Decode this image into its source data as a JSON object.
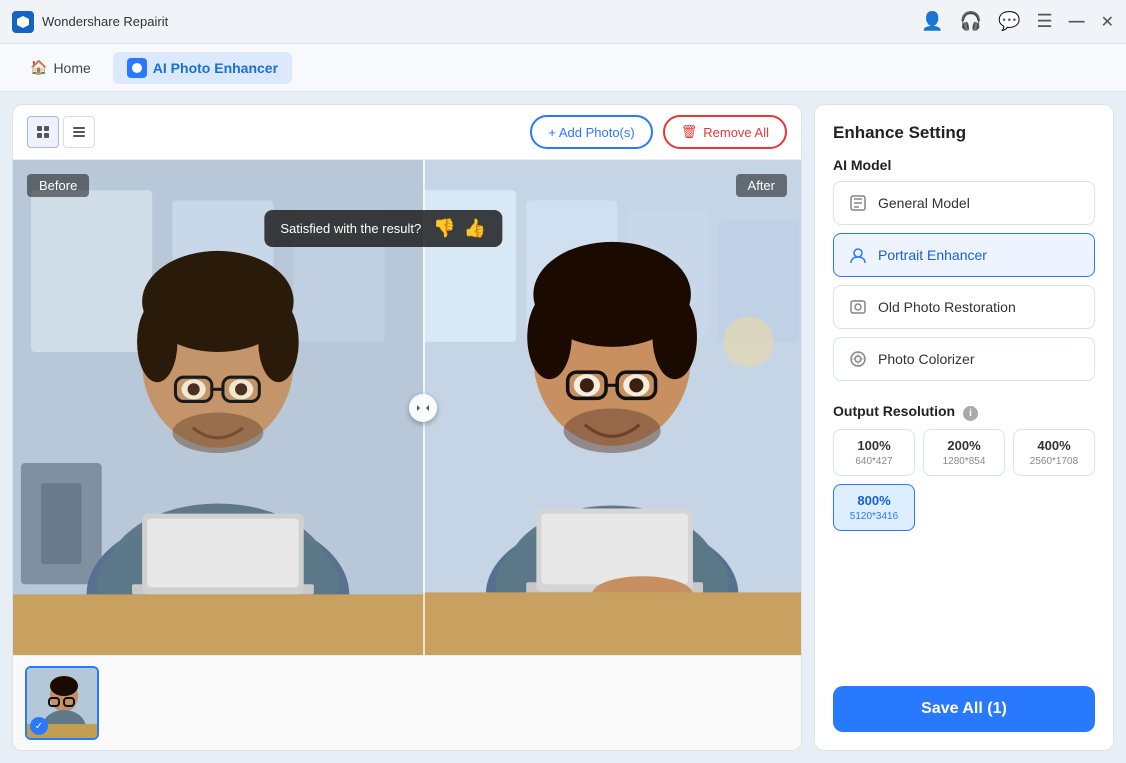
{
  "titleBar": {
    "appName": "Wondershare Repairit",
    "controls": {
      "minimize": "—",
      "close": "✕"
    }
  },
  "navBar": {
    "homeLabel": "Home",
    "activeTab": "AI Photo Enhancer"
  },
  "toolbar": {
    "addPhotosLabel": "+ Add Photo(s)",
    "removeAllLabel": "Remove All"
  },
  "preview": {
    "beforeLabel": "Before",
    "afterLabel": "After",
    "satisfiedText": "Satisfied with the result?"
  },
  "settings": {
    "title": "Enhance Setting",
    "aiModelLabel": "AI Model",
    "models": [
      {
        "id": "general",
        "label": "General Model",
        "active": false
      },
      {
        "id": "portrait",
        "label": "Portrait Enhancer",
        "active": true
      },
      {
        "id": "oldphoto",
        "label": "Old Photo Restoration",
        "active": false
      },
      {
        "id": "colorizer",
        "label": "Photo Colorizer",
        "active": false
      }
    ],
    "outputResolutionLabel": "Output Resolution",
    "resolutions": [
      {
        "pct": "100%",
        "size": "640*427",
        "active": false
      },
      {
        "pct": "200%",
        "size": "1280*854",
        "active": false
      },
      {
        "pct": "400%",
        "size": "2560*1708",
        "active": false
      },
      {
        "pct": "800%",
        "size": "5120*3416",
        "active": true
      }
    ],
    "saveButtonLabel": "Save All (1)"
  }
}
